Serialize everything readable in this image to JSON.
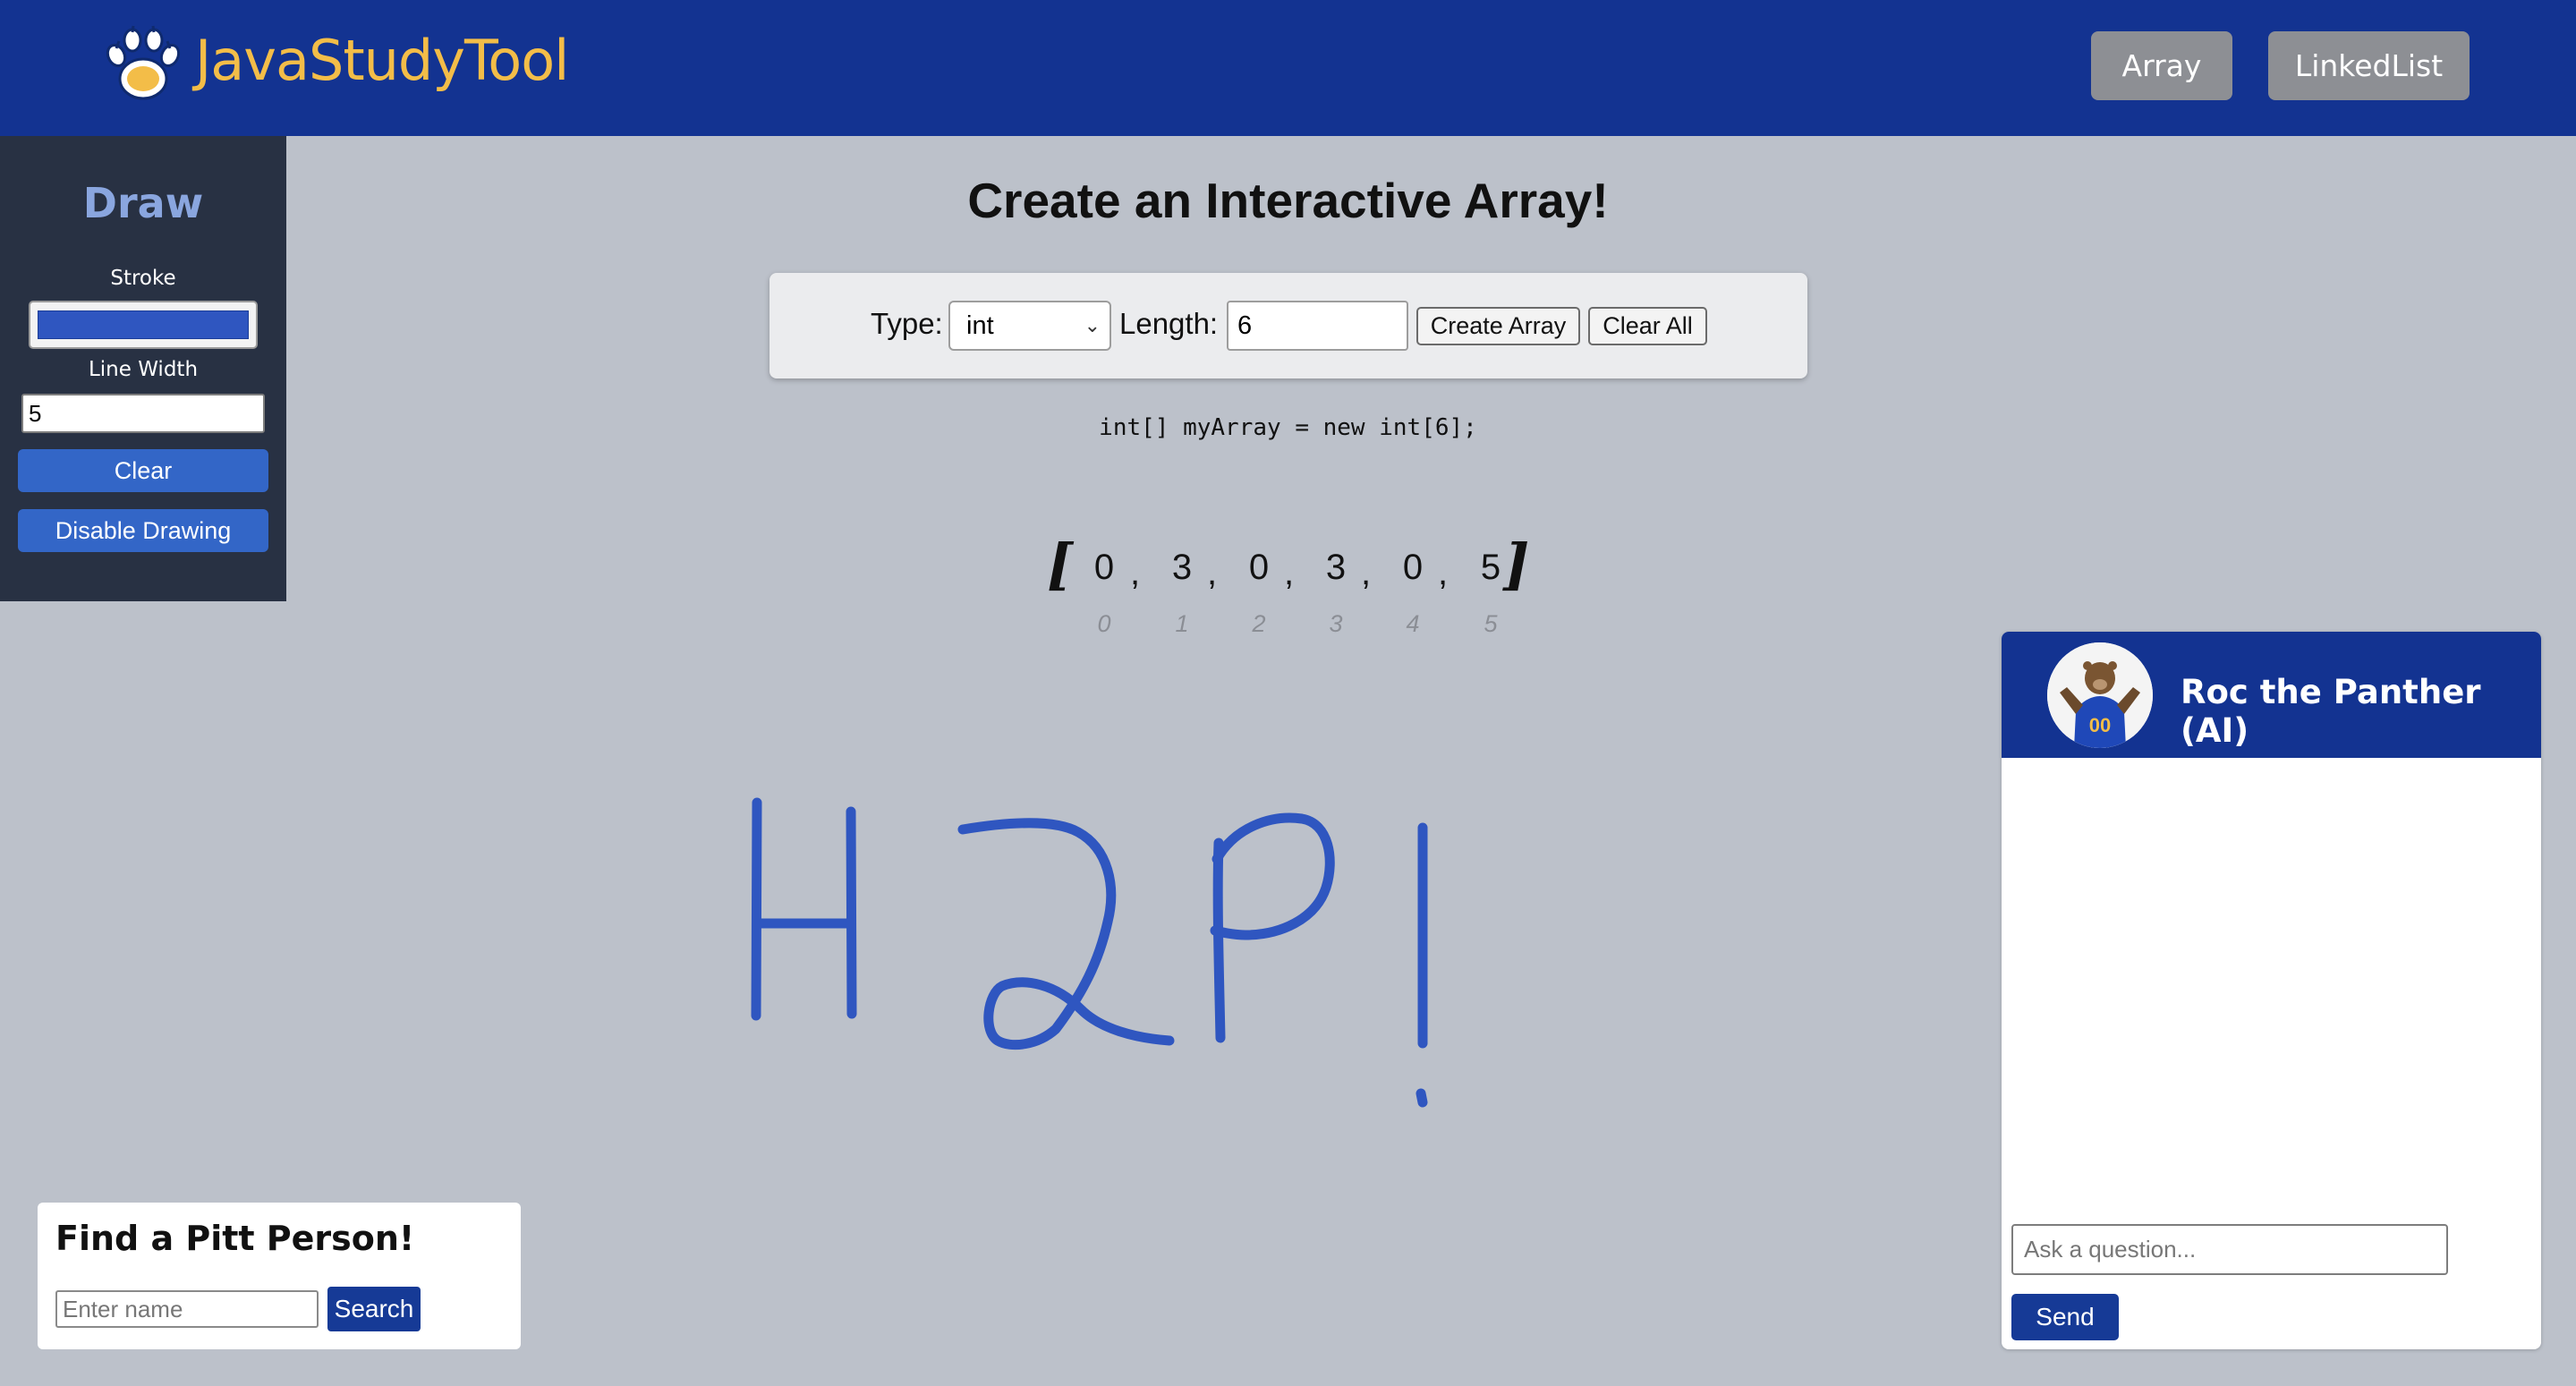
{
  "header": {
    "brand": "JavaStudyTool",
    "logo_icon": "paw-icon",
    "nav": {
      "array_label": "Array",
      "linkedlist_label": "LinkedList"
    }
  },
  "draw_panel": {
    "title": "Draw",
    "stroke_label": "Stroke",
    "stroke_color": "#2f56c0",
    "line_width_label": "Line Width",
    "line_width_value": "5",
    "clear_label": "Clear",
    "disable_label": "Disable Drawing"
  },
  "main": {
    "title": "Create an Interactive Array!",
    "controls": {
      "type_label": "Type:",
      "type_selected": "int",
      "length_label": "Length:",
      "length_value": "6",
      "create_label": "Create Array",
      "clear_all_label": "Clear All"
    },
    "code": "int[] myArray = new int[6];",
    "array": {
      "open": "[",
      "close": "]",
      "separator": ",",
      "values": [
        "0",
        "3",
        "0",
        "3",
        "0",
        "5"
      ],
      "indices": [
        "0",
        "1",
        "2",
        "3",
        "4",
        "5"
      ]
    },
    "drawing": {
      "description_icon": "handwriting-strokes",
      "color": "#2f56c0"
    }
  },
  "find_person": {
    "title": "Find a Pitt Person!",
    "placeholder": "Enter name",
    "search_label": "Search"
  },
  "chat": {
    "title": "Roc the Panther (AI)",
    "avatar_icon": "panther-mascot-avatar",
    "placeholder": "Ask a question...",
    "send_label": "Send"
  },
  "colors": {
    "header_bg": "#133391",
    "brand_text": "#f3bd48",
    "page_bg": "#bcc1ca",
    "sidebar_bg": "#283143",
    "button_blue": "#3366c7",
    "dark_blue_button": "#163a96"
  }
}
